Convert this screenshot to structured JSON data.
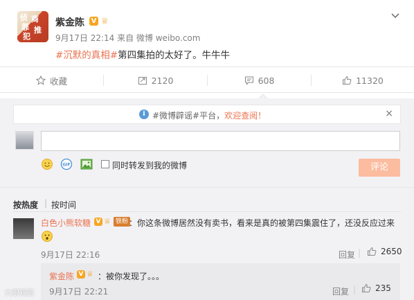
{
  "post": {
    "author": "紫金陈",
    "meta": "9月17日 22:14 来自 微博 weibo.com",
    "hashtag": "#沉默的真相#",
    "body": "第四集拍的太好了。牛牛牛"
  },
  "actions": {
    "favorite": "收藏",
    "repost_count": "2120",
    "comment_count": "608",
    "like_count": "11320"
  },
  "notice": {
    "tag": "#微博辟谣#平台，",
    "link": "欢迎查阅！"
  },
  "composer": {
    "repost_label": "同时转发到我的微博",
    "submit_label": "评论"
  },
  "sort": {
    "hot": "按热度",
    "time": "按时间"
  },
  "comment": {
    "author": "白色小熊软糖",
    "tag": "铁粉",
    "text": "：你这条微博居然没有卖书，看来是真的被第四集震住了，还没反应过来",
    "time": "9月17日 22:16",
    "reply_label": "回复",
    "like_count": "2650"
  },
  "reply": {
    "author": "紫金陈",
    "text": "：被你发现了。。。",
    "time": "9月17日 22:21",
    "reply_label": "回复",
    "like_count": "235"
  },
  "watermark": "大眼观影",
  "colors": {
    "accent": "#eb7350",
    "submit_disabled": "#fbbc9f",
    "badge_gold": "#f6a623",
    "panel_bg": "#f2f2f5"
  }
}
